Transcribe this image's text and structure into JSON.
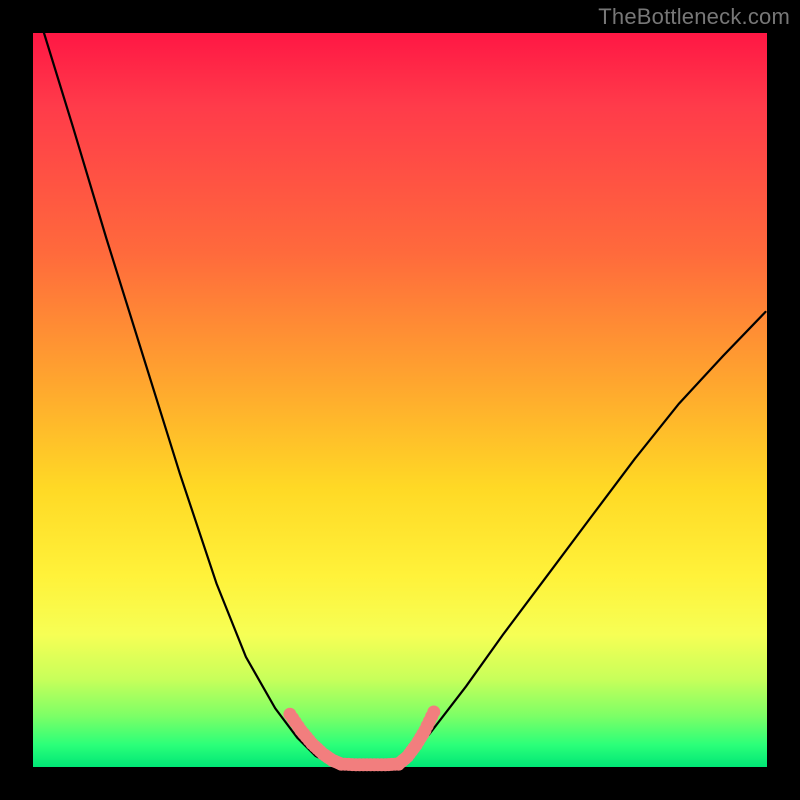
{
  "watermark": {
    "text": "TheBottleneck.com"
  },
  "gradient": {
    "stops": [
      "#ff1744",
      "#ff3b4a",
      "#ff6a3c",
      "#ffa72e",
      "#ffd925",
      "#fff23a",
      "#f6ff55",
      "#c8ff5a",
      "#7dff66",
      "#2bff79",
      "#00e676"
    ]
  },
  "chart_data": {
    "type": "line",
    "title": "",
    "xlabel": "",
    "ylabel": "",
    "xlim": [
      0,
      1
    ],
    "ylim": [
      0,
      1
    ],
    "note": "Axes are unlabeled; x and y are normalized to the plot rectangle (0 = left/bottom, 1 = right/top). Values estimated from pixels.",
    "series": [
      {
        "name": "left-curve",
        "stroke": "#000000",
        "x": [
          0.015,
          0.055,
          0.1,
          0.15,
          0.2,
          0.25,
          0.29,
          0.33,
          0.36,
          0.385,
          0.405
        ],
        "y": [
          1.0,
          0.87,
          0.72,
          0.56,
          0.4,
          0.25,
          0.15,
          0.08,
          0.04,
          0.015,
          0.005
        ]
      },
      {
        "name": "right-curve",
        "stroke": "#000000",
        "x": [
          0.498,
          0.54,
          0.59,
          0.64,
          0.7,
          0.76,
          0.82,
          0.88,
          0.94,
          0.998
        ],
        "y": [
          0.005,
          0.045,
          0.11,
          0.18,
          0.26,
          0.34,
          0.42,
          0.495,
          0.56,
          0.62
        ]
      },
      {
        "name": "left-valley-highlight",
        "stroke": "#f27e7e",
        "style": "dotted-thick",
        "x": [
          0.35,
          0.365,
          0.38,
          0.395,
          0.408,
          0.42
        ],
        "y": [
          0.072,
          0.05,
          0.032,
          0.018,
          0.009,
          0.004
        ]
      },
      {
        "name": "bottom-highlight",
        "stroke": "#f27e7e",
        "style": "dotted-thick",
        "x": [
          0.42,
          0.44,
          0.46,
          0.48,
          0.498
        ],
        "y": [
          0.004,
          0.003,
          0.003,
          0.003,
          0.004
        ]
      },
      {
        "name": "right-valley-highlight",
        "stroke": "#f27e7e",
        "style": "dotted-thick",
        "x": [
          0.498,
          0.51,
          0.522,
          0.534,
          0.546
        ],
        "y": [
          0.004,
          0.014,
          0.03,
          0.05,
          0.075
        ]
      }
    ]
  }
}
